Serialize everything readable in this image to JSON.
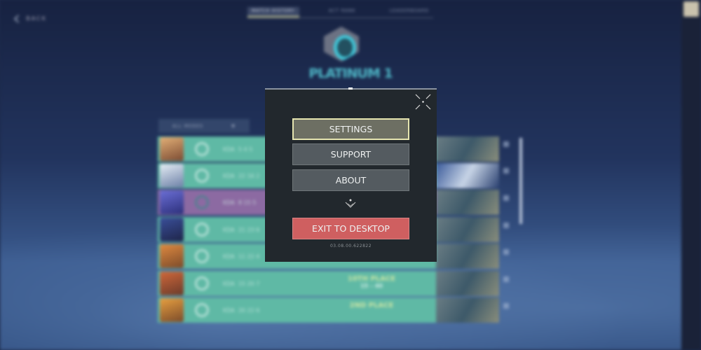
{
  "header": {
    "back_label": "BACK",
    "tabs": [
      "MATCH HISTORY",
      "ACT RANK",
      "LEADERBOARD"
    ],
    "active_tab": "MATCH HISTORY",
    "rank": "PLATINUM 1"
  },
  "filter": {
    "mode": "ALL MODES"
  },
  "matches": [
    {
      "kda_label": "KDA",
      "kda": "5 4 5"
    },
    {
      "kda_label": "KDA",
      "kda": "22 16 2"
    },
    {
      "kda_label": "KDA",
      "kda": "8 15 5"
    },
    {
      "kda_label": "KDA",
      "kda": "21 23 6"
    },
    {
      "kda_label": "KDA",
      "kda": "11 22 4"
    },
    {
      "kda_label": "KDA",
      "kda": "15 20 7",
      "place": "10TH PLACE",
      "score": "15 – 40"
    },
    {
      "kda_label": "KDA",
      "kda": "20 22 6",
      "place": "2ND PLACE"
    }
  ],
  "menu": {
    "settings": "SETTINGS",
    "support": "SUPPORT",
    "about": "ABOUT",
    "exit": "EXIT TO DESKTOP",
    "version": "03.08.00.622822"
  },
  "colors": {
    "accent_exit": "#cf5f60",
    "row_teal": "#5fb9a5",
    "row_purple": "#8c6aa2",
    "selected_border": "#e6e5b0"
  }
}
